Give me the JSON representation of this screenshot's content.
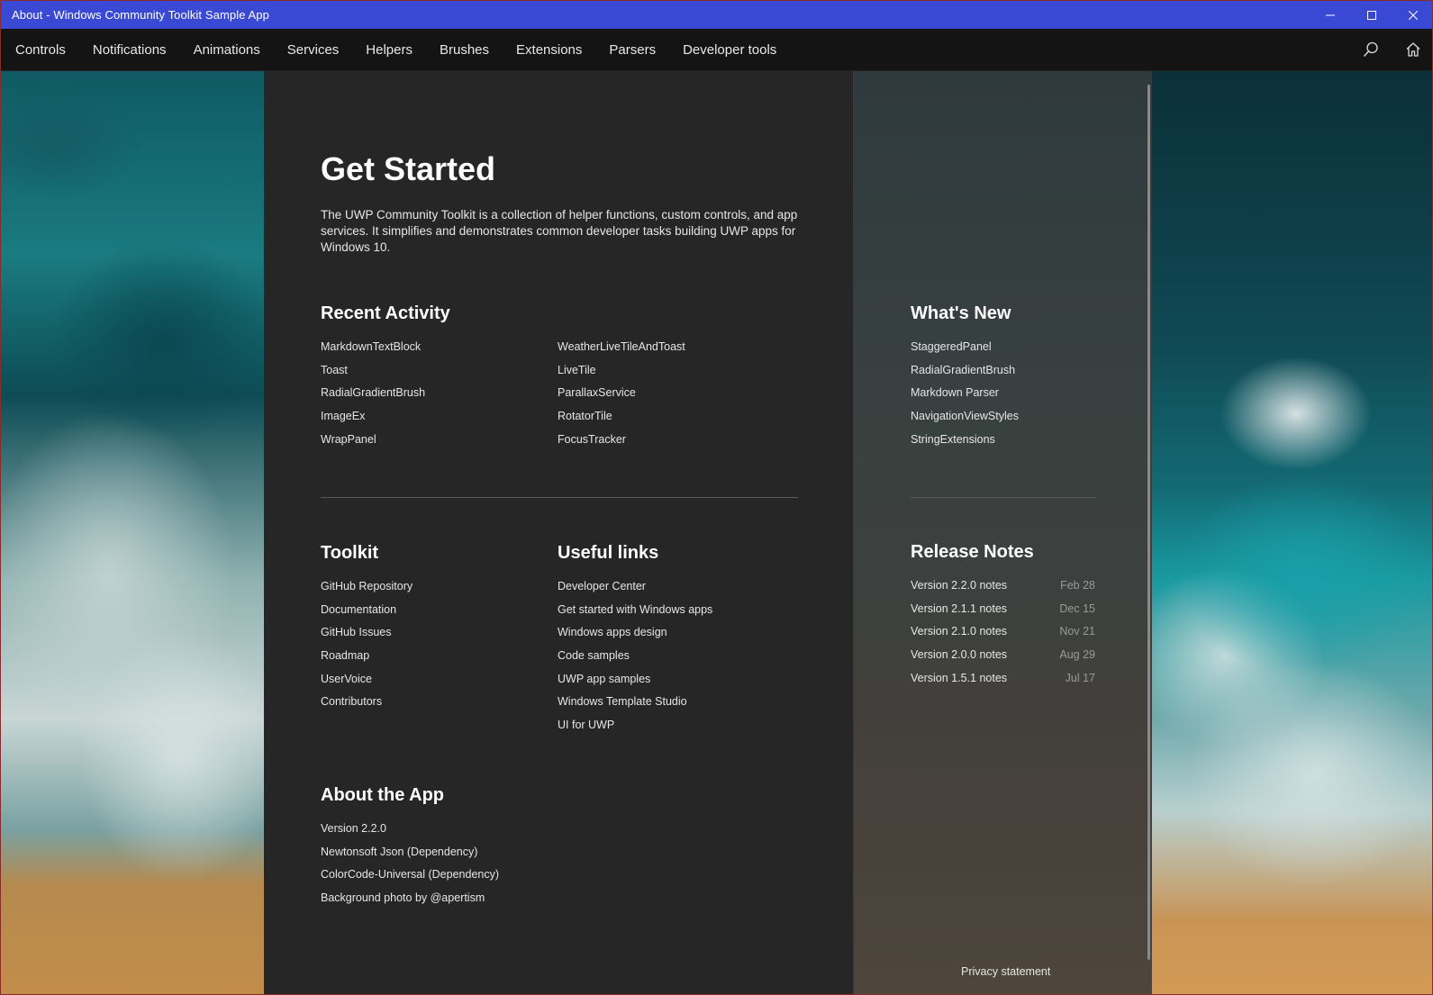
{
  "window": {
    "title": "About - Windows Community Toolkit Sample App"
  },
  "nav": {
    "items": [
      {
        "label": "Controls"
      },
      {
        "label": "Notifications"
      },
      {
        "label": "Animations"
      },
      {
        "label": "Services"
      },
      {
        "label": "Helpers"
      },
      {
        "label": "Brushes"
      },
      {
        "label": "Extensions"
      },
      {
        "label": "Parsers"
      },
      {
        "label": "Developer tools"
      }
    ],
    "icons": [
      "search-icon",
      "home-icon"
    ]
  },
  "get_started": {
    "title": "Get Started",
    "description": "The UWP Community Toolkit is a collection of helper functions, custom controls, and app services. It simplifies and demonstrates common developer tasks building UWP apps for Windows 10."
  },
  "recent_activity": {
    "title": "Recent Activity",
    "col1": [
      "MarkdownTextBlock",
      "Toast",
      "RadialGradientBrush",
      "ImageEx",
      "WrapPanel"
    ],
    "col2": [
      "WeatherLiveTileAndToast",
      "LiveTile",
      "ParallaxService",
      "RotatorTile",
      "FocusTracker"
    ]
  },
  "whats_new": {
    "title": "What's New",
    "items": [
      "StaggeredPanel",
      "RadialGradientBrush",
      "Markdown Parser",
      "NavigationViewStyles",
      "StringExtensions"
    ]
  },
  "toolkit": {
    "title": "Toolkit",
    "items": [
      "GitHub Repository",
      "Documentation",
      "GitHub Issues",
      "Roadmap",
      "UserVoice",
      "Contributors"
    ]
  },
  "useful_links": {
    "title": "Useful links",
    "items": [
      "Developer Center",
      "Get started with Windows apps",
      "Windows apps design",
      "Code samples",
      "UWP app samples",
      "Windows Template Studio",
      "UI for UWP"
    ]
  },
  "release_notes": {
    "title": "Release Notes",
    "items": [
      {
        "label": "Version 2.2.0 notes",
        "date": "Feb 28"
      },
      {
        "label": "Version 2.1.1 notes",
        "date": "Dec 15"
      },
      {
        "label": "Version 2.1.0 notes",
        "date": "Nov 21"
      },
      {
        "label": "Version 2.0.0 notes",
        "date": "Aug 29"
      },
      {
        "label": "Version 1.5.1 notes",
        "date": "Jul 17"
      }
    ]
  },
  "about_app": {
    "title": "About the App",
    "items": [
      "Version 2.2.0",
      "Newtonsoft Json (Dependency)",
      "ColorCode-Universal (Dependency)",
      "Background photo by @apertism"
    ]
  },
  "footer": {
    "privacy": "Privacy statement"
  },
  "colors": {
    "titlebar": "#3949d4",
    "navbar": "#141414",
    "panel": "#262626"
  }
}
